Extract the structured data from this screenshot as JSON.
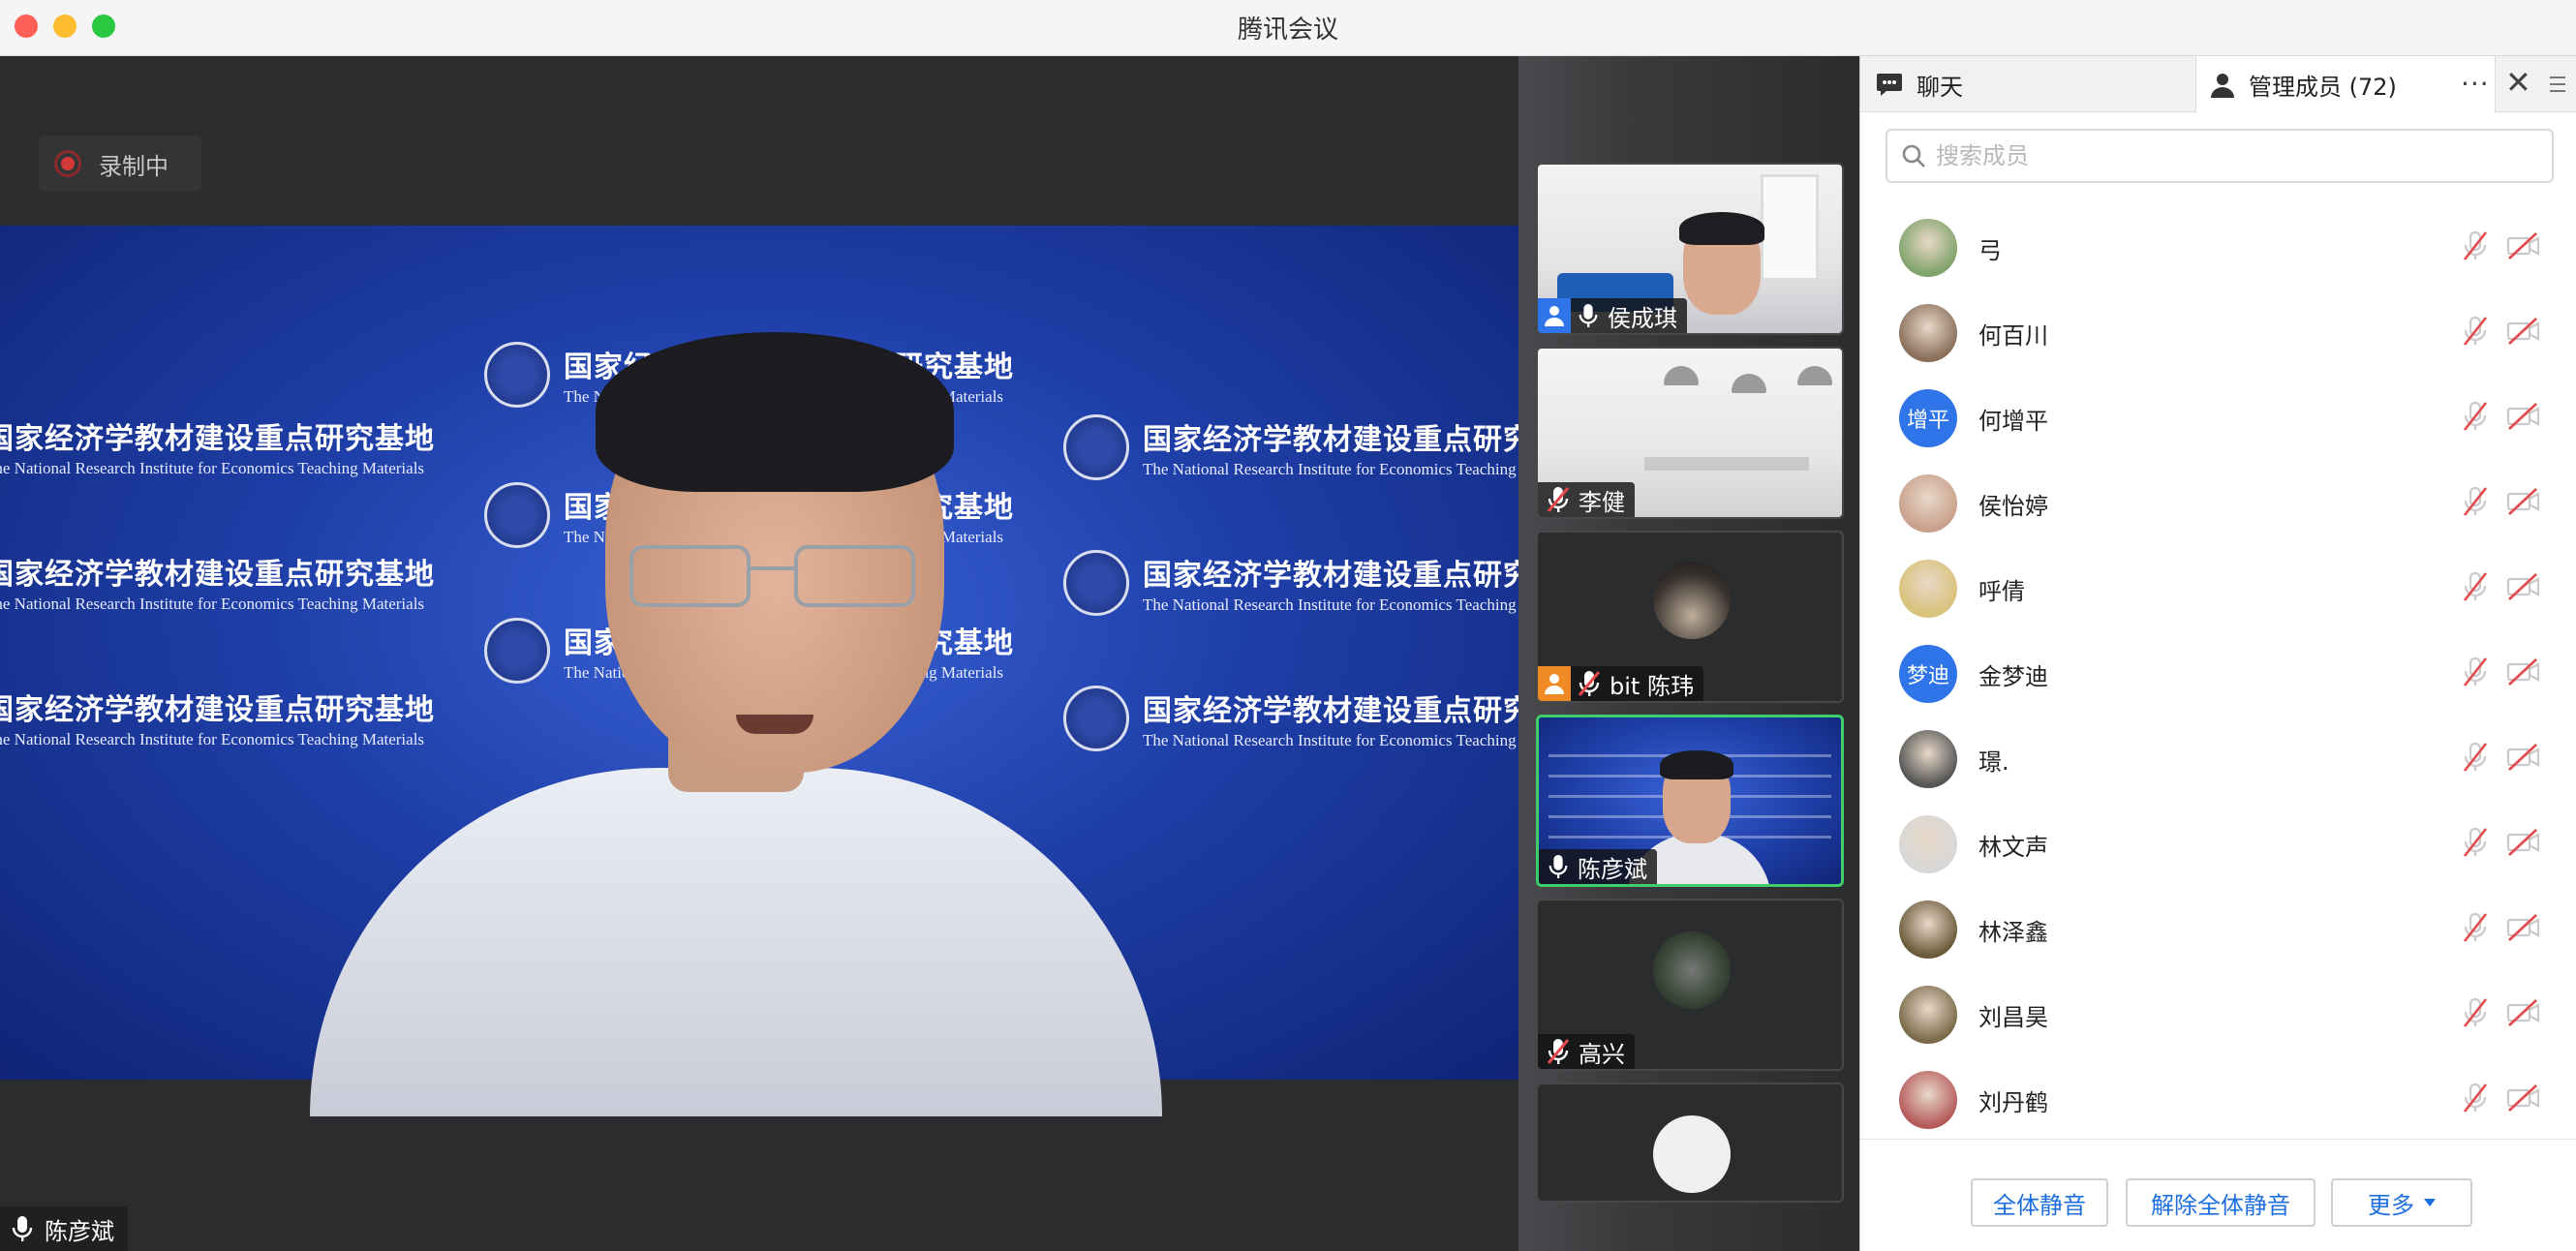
{
  "window": {
    "title": "腾讯会议"
  },
  "recording": {
    "label": "录制中"
  },
  "main_video": {
    "speaker_name": "陈彦斌",
    "backdrop_cn": "国家经济学教材建设重点研究基地",
    "backdrop_en": "The National Research Institute for Economics Teaching Materials"
  },
  "gallery": [
    {
      "name": "侯成琪",
      "host": true,
      "host_color": "#2f74e8",
      "mic_muted": false
    },
    {
      "name": "李健",
      "host": false,
      "mic_muted": true
    },
    {
      "name": "bit 陈玮",
      "host": true,
      "host_color": "#f08a24",
      "mic_muted": true
    },
    {
      "name": "陈彦斌",
      "host": false,
      "mic_muted": false,
      "active": true
    },
    {
      "name": "高兴",
      "host": false,
      "mic_muted": true
    },
    {
      "name": "",
      "host": false
    }
  ],
  "panel": {
    "tab_chat": "聊天",
    "tab_members": "管理成员 (72)",
    "search_placeholder": "搜索成员",
    "members": [
      {
        "name": "弓",
        "avatar": "image"
      },
      {
        "name": "何百川",
        "avatar": "image"
      },
      {
        "name": "何增平",
        "avatar": "text",
        "avatar_text": "增平",
        "avatar_color": "#2f74e8"
      },
      {
        "name": "侯怡婷",
        "avatar": "image"
      },
      {
        "name": "呼倩",
        "avatar": "image"
      },
      {
        "name": "金梦迪",
        "avatar": "text",
        "avatar_text": "梦迪",
        "avatar_color": "#2f74e8"
      },
      {
        "name": "璟.",
        "avatar": "image"
      },
      {
        "name": "林文声",
        "avatar": "image"
      },
      {
        "name": "林泽鑫",
        "avatar": "image"
      },
      {
        "name": "刘昌昊",
        "avatar": "image"
      },
      {
        "name": "刘丹鹤",
        "avatar": "image"
      }
    ],
    "buttons": {
      "mute_all": "全体静音",
      "unmute_all": "解除全体静音",
      "more": "更多"
    }
  },
  "colors": {
    "accent": "#1d6fe0",
    "active_tile_border": "#3ecf6a",
    "muted_icon": "#c9c9c9",
    "record_red": "#d53a3a"
  }
}
